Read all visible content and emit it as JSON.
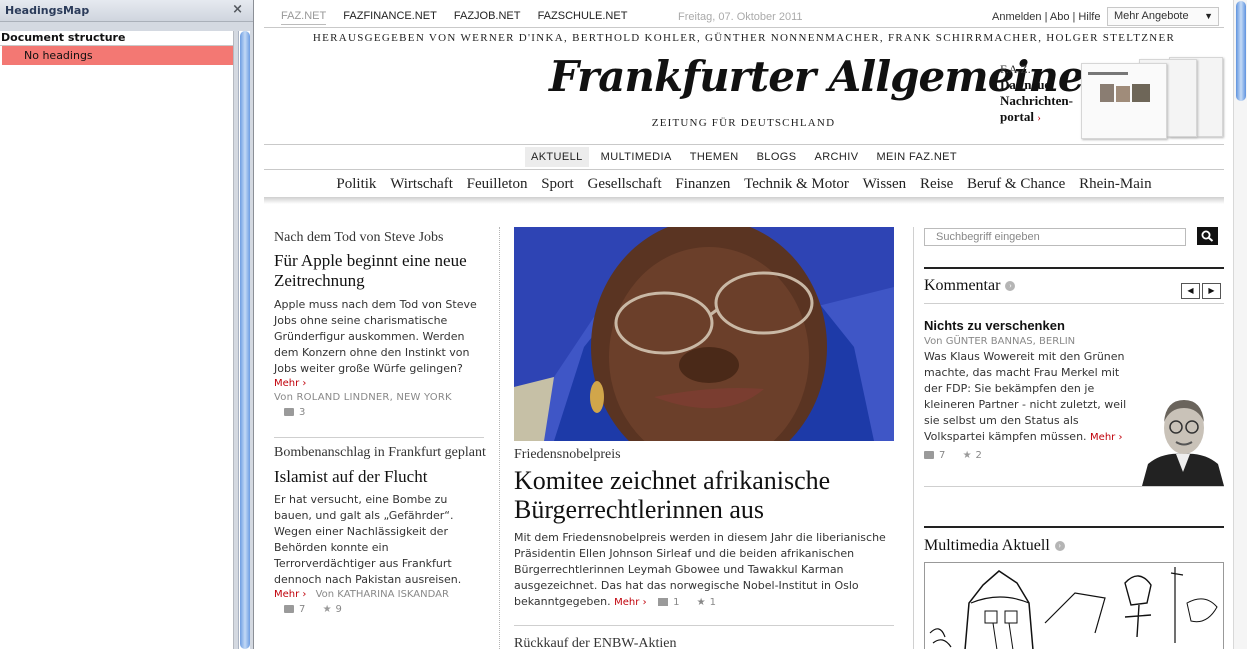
{
  "sidebar": {
    "title": "HeadingsMap",
    "close": "×",
    "section": "Document structure",
    "row": "No headings"
  },
  "topbar": {
    "links": [
      "FAZ.NET",
      "FAZFINANCE.NET",
      "FAZJOB.NET",
      "FAZSCHULE.NET"
    ],
    "date": "Freitag, 07. Oktober 2011",
    "right": "Anmelden  | Abo | Hilfe",
    "offers": "Mehr Angebote"
  },
  "header": {
    "publishers": "HERAUSGEGEBEN VON WERNER D'INKA, BERTHOLD KOHLER, GÜNTHER NONNENMACHER, FRANK SCHIRRMACHER, HOLGER STELTZNER",
    "masthead": "Frankfurter Allgemeine",
    "subhead": "ZEITUNG FÜR DEUTSCHLAND",
    "promo_kicker": "F.A.Z.",
    "promo_line1": "Das neue",
    "promo_line2": "Nachrichten-",
    "promo_line3": "portal",
    "promo_chevron": "›"
  },
  "nav_primary": [
    "AKTUELL",
    "MULTIMEDIA",
    "THEMEN",
    "BLOGS",
    "ARCHIV",
    "MEIN FAZ.NET"
  ],
  "nav_sections": [
    "Politik",
    "Wirtschaft",
    "Feuilleton",
    "Sport",
    "Gesellschaft",
    "Finanzen",
    "Technik & Motor",
    "Wissen",
    "Reise",
    "Beruf & Chance",
    "Rhein-Main"
  ],
  "left": {
    "a1": {
      "kicker": "Nach dem Tod von Steve Jobs",
      "headline": "Für Apple beginnt eine neue Zeitrechnung",
      "teaser": "Apple muss nach dem Tod von Steve Jobs ohne seine charismatische Gründerfigur auskommen. Werden dem Konzern ohne den Instinkt von Jobs weiter große Würfe gelingen?",
      "more": "Mehr",
      "byline": "Von ROLAND LINDNER, NEW YORK",
      "comments": "3"
    },
    "a2": {
      "kicker": "Bombenanschlag in Frankfurt geplant",
      "headline": "Islamist auf der Flucht",
      "teaser": "Er hat versucht, eine Bombe zu bauen, und galt als „Gefährder“. Wegen einer Nachlässigkeit der Behörden konnte ein Terrorverdächtiger aus Frankfurt dennoch nach Pakistan ausreisen.",
      "more": "Mehr",
      "byline": "Von KATHARINA ISKANDAR",
      "comments": "7",
      "stars": "9"
    }
  },
  "center": {
    "kicker": "Friedensnobelpreis",
    "headline": "Komitee zeichnet afrikanische Bürgerrechtlerinnen aus",
    "teaser": "Mit dem Friedensnobelpreis werden in diesem Jahr die liberianische Präsidentin Ellen Johnson Sirleaf und die beiden afrikanischen Bürgerrechtlerinnen Leymah Gbowee und Tawakkul Karman ausgezeichnet. Das hat das norwegische Nobel-Institut in Oslo bekanntgegeben.",
    "more": "Mehr",
    "comments": "1",
    "stars": "1",
    "next_kicker": "Rückkauf der ENBW-Aktien"
  },
  "right": {
    "search_placeholder": "Suchbegriff eingeben",
    "comment_section": "Kommentar",
    "comment_title": "Nichts zu verschenken",
    "comment_by": "Von GÜNTER BANNAS, BERLIN",
    "comment_teaser": "Was Klaus Wowereit mit den Grünen machte, das macht Frau Merkel mit der FDP: Sie bekämpfen den je kleineren Partner - nicht zuletzt, weil sie selbst um den Status als Volkspartei kämpfen müssen.",
    "more": "Mehr",
    "comments": "7",
    "stars": "2",
    "multimedia_section": "Multimedia Aktuell"
  },
  "colors": {
    "accent_red": "#c0000a",
    "sidebar_highlight": "#f37873",
    "photo_blue": "#3f56c6"
  }
}
